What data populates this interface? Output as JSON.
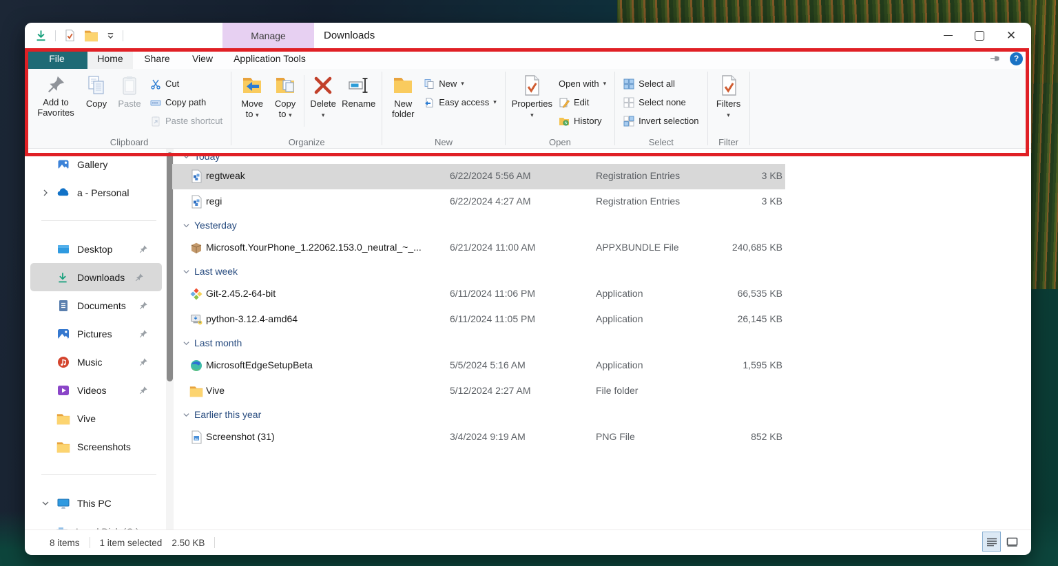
{
  "titlebar": {
    "title": "Downloads",
    "contextual_tab": "Manage"
  },
  "tabs": {
    "file": "File",
    "home": "Home",
    "share": "Share",
    "view": "View",
    "app_tools": "Application Tools"
  },
  "ribbon": {
    "clipboard": {
      "label": "Clipboard",
      "add_to_favorites": "Add to Favorites",
      "copy": "Copy",
      "paste": "Paste",
      "cut": "Cut",
      "copy_path": "Copy path",
      "paste_shortcut": "Paste shortcut"
    },
    "organize": {
      "label": "Organize",
      "move_to_1": "Move",
      "move_to_2": "to",
      "copy_to_1": "Copy",
      "copy_to_2": "to",
      "delete": "Delete",
      "rename": "Rename"
    },
    "new_group": {
      "label": "New",
      "new_folder_1": "New",
      "new_folder_2": "folder",
      "new_item": "New",
      "easy_access": "Easy access"
    },
    "open_group": {
      "label": "Open",
      "properties": "Properties",
      "open_with": "Open with",
      "edit": "Edit",
      "history": "History"
    },
    "select_group": {
      "label": "Select",
      "select_all": "Select all",
      "select_none": "Select none",
      "invert": "Invert selection"
    },
    "filter_group": {
      "label": "Filter",
      "filters": "Filters"
    }
  },
  "sidebar": {
    "items": [
      {
        "label": "Gallery"
      },
      {
        "label": "a - Personal"
      },
      {
        "label": "Desktop"
      },
      {
        "label": "Downloads"
      },
      {
        "label": "Documents"
      },
      {
        "label": "Pictures"
      },
      {
        "label": "Music"
      },
      {
        "label": "Videos"
      },
      {
        "label": "Vive"
      },
      {
        "label": "Screenshots"
      },
      {
        "label": "This PC"
      },
      {
        "label": "Local Disk (C:)"
      }
    ]
  },
  "files": {
    "groups": [
      {
        "header": "Today"
      },
      {
        "header": "Yesterday"
      },
      {
        "header": "Last week"
      },
      {
        "header": "Last month"
      },
      {
        "header": "Earlier this year"
      }
    ],
    "items": [
      {
        "name": "regtweak",
        "date": "6/22/2024 5:56 AM",
        "type": "Registration Entries",
        "size": "3 KB"
      },
      {
        "name": "regi",
        "date": "6/22/2024 4:27 AM",
        "type": "Registration Entries",
        "size": "3 KB"
      },
      {
        "name": "Microsoft.YourPhone_1.22062.153.0_neutral_~_...",
        "date": "6/21/2024 11:00 AM",
        "type": "APPXBUNDLE File",
        "size": "240,685 KB"
      },
      {
        "name": "Git-2.45.2-64-bit",
        "date": "6/11/2024 11:06 PM",
        "type": "Application",
        "size": "66,535 KB"
      },
      {
        "name": "python-3.12.4-amd64",
        "date": "6/11/2024 11:05 PM",
        "type": "Application",
        "size": "26,145 KB"
      },
      {
        "name": "MicrosoftEdgeSetupBeta",
        "date": "5/5/2024 5:16 AM",
        "type": "Application",
        "size": "1,595 KB"
      },
      {
        "name": "Vive",
        "date": "5/12/2024 2:27 AM",
        "type": "File folder",
        "size": ""
      },
      {
        "name": "Screenshot (31)",
        "date": "3/4/2024 9:19 AM",
        "type": "PNG File",
        "size": "852 KB"
      }
    ]
  },
  "statusbar": {
    "count": "8 items",
    "selected": "1 item selected",
    "selected_size": "2.50 KB"
  },
  "colors": {
    "accent_teal": "#1e6a75",
    "contextual_tab_bg": "#e7d0f2",
    "highlight_red": "#e02025",
    "selection_gray": "#d9d9d9"
  }
}
